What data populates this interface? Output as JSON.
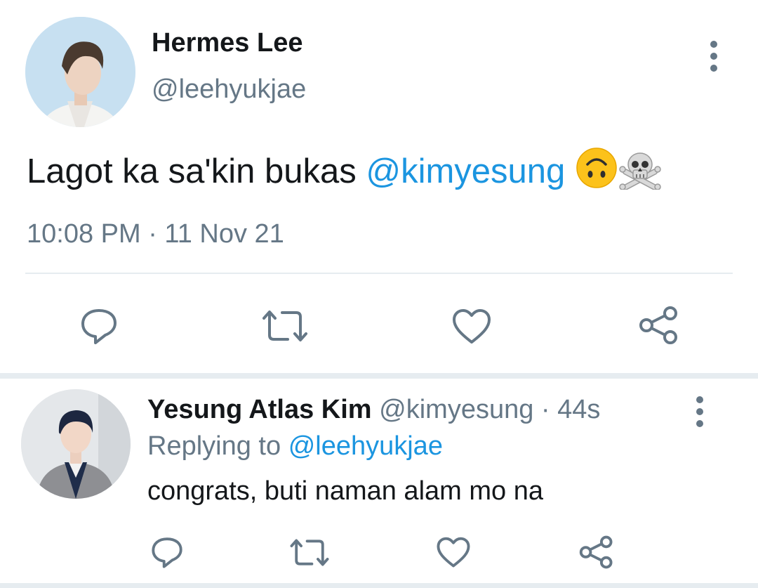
{
  "tweet": {
    "author_name": "Hermes Lee",
    "author_handle": "@leehyukjae",
    "text_prefix": "Lagot ka sa'kin bukas ",
    "mention": "@kimyesung",
    "timestamp": "10:08 PM · 11 Nov 21"
  },
  "reply": {
    "author_name": "Yesung Atlas Kim",
    "author_handle": "@kimyesung",
    "separator": " · ",
    "age": "44s",
    "replying_to_label": "Replying to",
    "replying_to_handle": "@leehyukjae",
    "text": "congrats, buti naman alam mo na"
  },
  "icons": {
    "main_actions": [
      "reply-icon",
      "retweet-icon",
      "like-icon",
      "share-icon"
    ],
    "reply_actions": [
      "reply-icon",
      "retweet-icon",
      "like-icon",
      "share-icon"
    ],
    "emojis": [
      "upside-down-face-emoji",
      "skull-and-crossbones-emoji"
    ]
  },
  "colors": {
    "link": "#1b95e0",
    "secondary_text": "#657786",
    "primary_text": "#14171a",
    "divider": "#e6ecf0"
  }
}
